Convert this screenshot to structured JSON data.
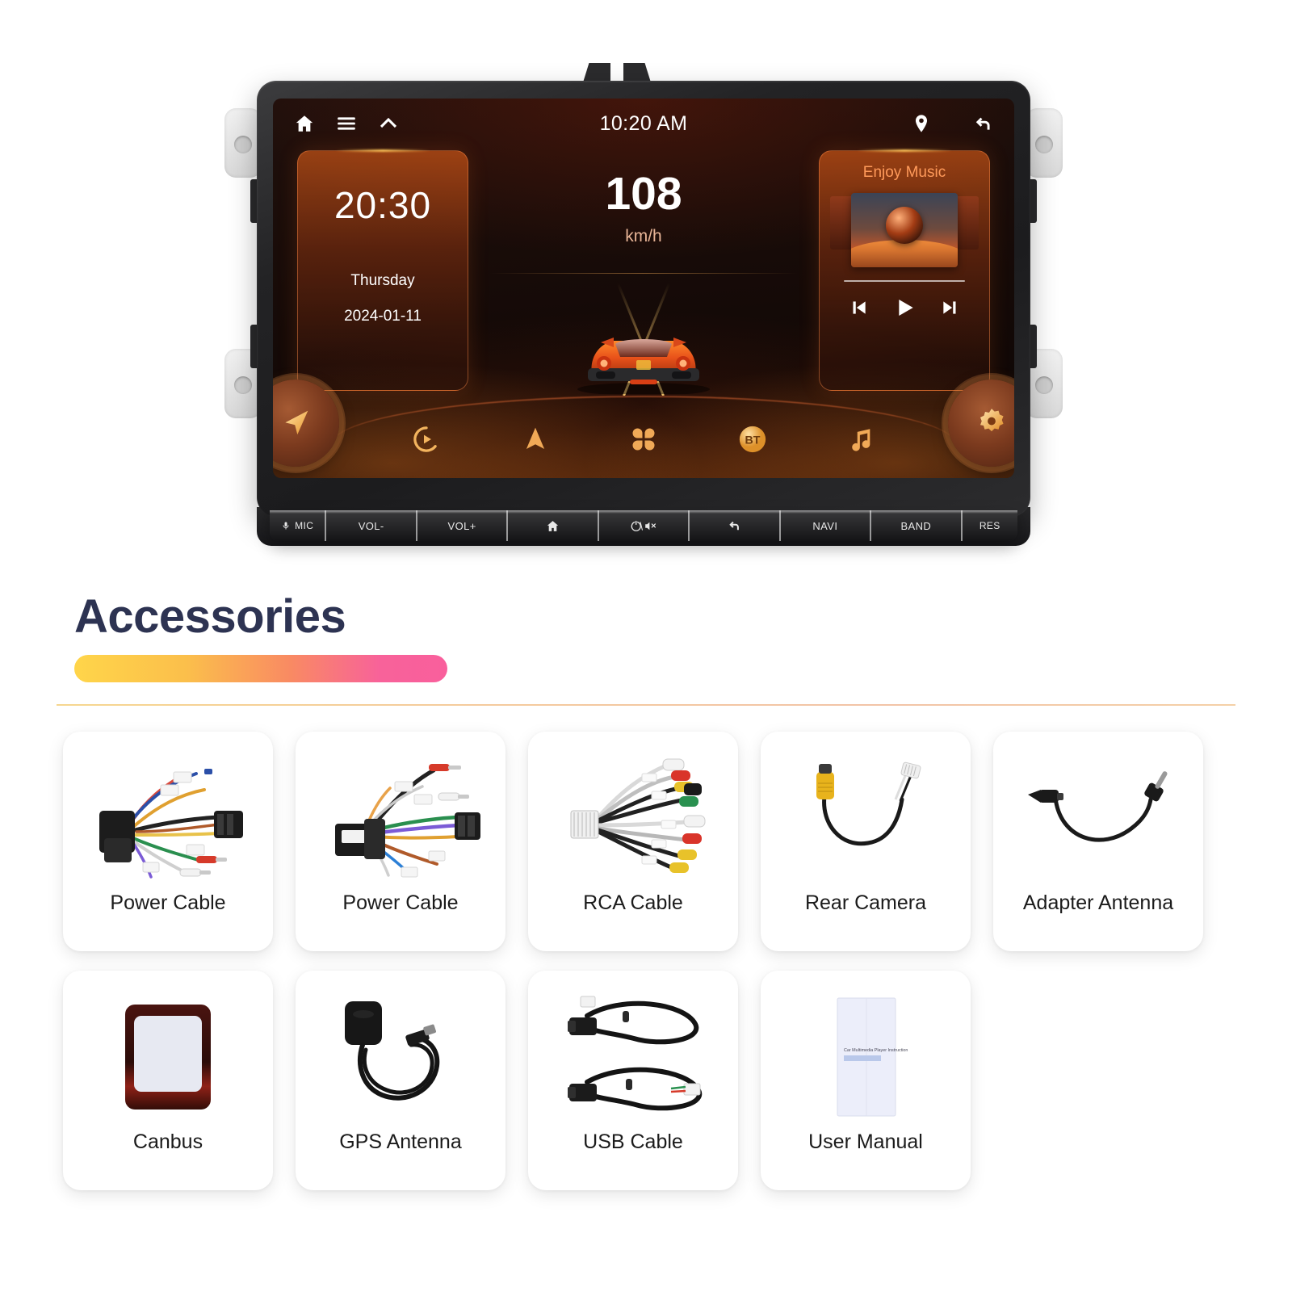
{
  "head_unit": {
    "status_bar": {
      "home_icon": "home-icon",
      "menu_icon": "menu-icon",
      "chevron_up_icon": "chevron-up-icon",
      "clock": "10:20 AM",
      "location_icon": "location-pin-icon",
      "back_icon": "back-arrow-icon"
    },
    "clock_widget": {
      "time": "20:30",
      "weekday": "Thursday",
      "date": "2024-01-11"
    },
    "speed_widget": {
      "value": "108",
      "unit": "km/h",
      "vehicle_icon": "sports-car-icon"
    },
    "music_widget": {
      "title": "Enjoy Music",
      "album_art": "album-art-desert-sphere",
      "prev_icon": "previous-track-icon",
      "play_icon": "play-icon",
      "next_icon": "next-track-icon"
    },
    "dock": {
      "nav_button_icon": "navigation-arrow-icon",
      "settings_button_icon": "settings-gear-icon",
      "apps": [
        {
          "name": "carplay",
          "icon": "carplay-icon",
          "label": ""
        },
        {
          "name": "navigation",
          "icon": "navigation-icon",
          "label": ""
        },
        {
          "name": "all-apps",
          "icon": "apps-grid-icon",
          "label": ""
        },
        {
          "name": "bluetooth",
          "icon": "bluetooth-icon",
          "label": "BT"
        },
        {
          "name": "music",
          "icon": "music-note-icon",
          "label": ""
        }
      ]
    },
    "hard_keys": [
      {
        "name": "mic",
        "label": "MIC",
        "icon": "microphone-icon"
      },
      {
        "name": "vol-down",
        "label": "VOL-",
        "icon": ""
      },
      {
        "name": "vol-up",
        "label": "VOL+",
        "icon": ""
      },
      {
        "name": "home",
        "label": "",
        "icon": "home-icon"
      },
      {
        "name": "power-mute",
        "label": "",
        "icon": "power-mute-icon"
      },
      {
        "name": "back",
        "label": "",
        "icon": "back-arrow-icon"
      },
      {
        "name": "navi",
        "label": "NAVI",
        "icon": ""
      },
      {
        "name": "band",
        "label": "BAND",
        "icon": ""
      },
      {
        "name": "reset",
        "label": "RES",
        "icon": ""
      }
    ]
  },
  "accessories": {
    "heading": "Accessories",
    "row1": [
      {
        "label": "Power Cable",
        "art": "power-cable-harness"
      },
      {
        "label": "Power Cable",
        "art": "power-cable-harness-2"
      },
      {
        "label": "RCA Cable",
        "art": "rca-cable-fanout"
      },
      {
        "label": "Rear Camera",
        "art": "rear-camera-adapter"
      },
      {
        "label": "Adapter Antenna",
        "art": "adapter-antenna"
      }
    ],
    "row2": [
      {
        "label": "Canbus",
        "art": "canbus-box"
      },
      {
        "label": "GPS Antenna",
        "art": "gps-antenna"
      },
      {
        "label": "USB Cable",
        "art": "usb-cables"
      },
      {
        "label": "User Manual",
        "art": "user-manual",
        "cover_text": "Car Multimedia Player Instruction"
      }
    ]
  },
  "colors": {
    "accent_orange": "#ff8c3a",
    "heading_navy": "#2d3352",
    "bar_yellow": "#ffd54a",
    "bar_pink": "#f95f9c"
  }
}
